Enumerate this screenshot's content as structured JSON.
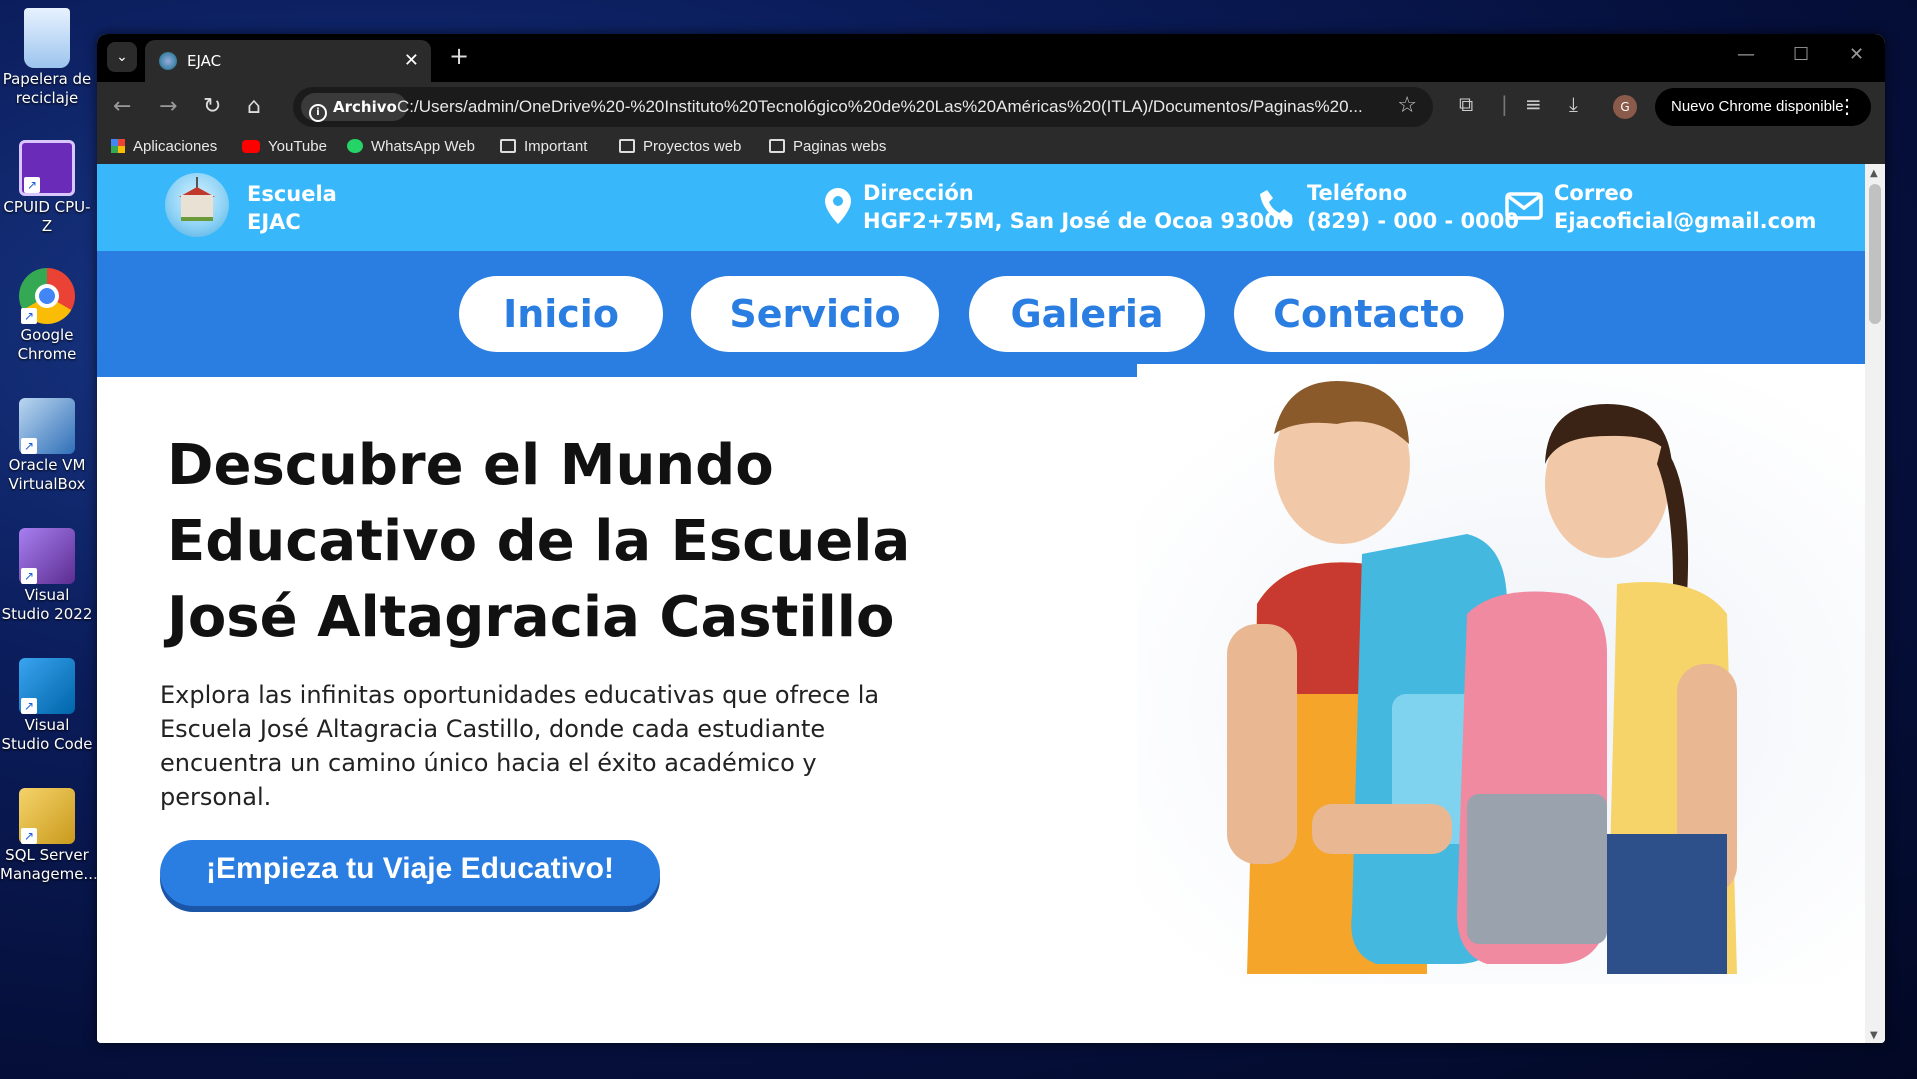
{
  "desktop": {
    "icons": [
      {
        "label": "Papelera de reciclaje"
      },
      {
        "label": "CPUID CPU-Z"
      },
      {
        "label": "Google Chrome"
      },
      {
        "label": "Oracle VM VirtualBox"
      },
      {
        "label": "Visual Studio 2022"
      },
      {
        "label": "Visual Studio Code"
      },
      {
        "label": "SQL Server Manageme..."
      }
    ]
  },
  "browser": {
    "tab_title": "EJAC",
    "omnibox": {
      "chip_label": "Archivo",
      "url": "C:/Users/admin/OneDrive%20-%20Instituto%20Tecnológico%20de%20Las%20Américas%20(ITLA)/Documentos/Paginas%20..."
    },
    "update_label": "Nuevo Chrome disponible",
    "avatar_letter": "G",
    "bookmarks": [
      "Aplicaciones",
      "YouTube",
      "WhatsApp Web",
      "Important",
      "Proyectos web",
      "Paginas webs"
    ]
  },
  "site": {
    "brand": {
      "line1": "Escuela",
      "line2": "EJAC"
    },
    "contact": {
      "address": {
        "label": "Dirección",
        "value": "HGF2+75M, San José de Ocoa 93000"
      },
      "phone": {
        "label": "Teléfono",
        "value": "(829) - 000 - 0000"
      },
      "email": {
        "label": "Correo",
        "value": "Ejacoficial@gmail.com"
      }
    },
    "nav": [
      "Inicio",
      "Servicio",
      "Galeria",
      "Contacto"
    ],
    "hero": {
      "title": "Descubre el Mundo Educativo de la Escuela José Altagracia Castillo",
      "text": "Explora las infinitas oportunidades educativas que ofrece la Escuela José Altagracia Castillo, donde cada estudiante encuentra un camino único hacia el éxito académico y personal.",
      "cta": "¡Empieza tu Viaje Educativo!"
    }
  },
  "colors": {
    "topbar": "#38b8fb",
    "navbar": "#2a7de1",
    "accent": "#2a7de1"
  }
}
